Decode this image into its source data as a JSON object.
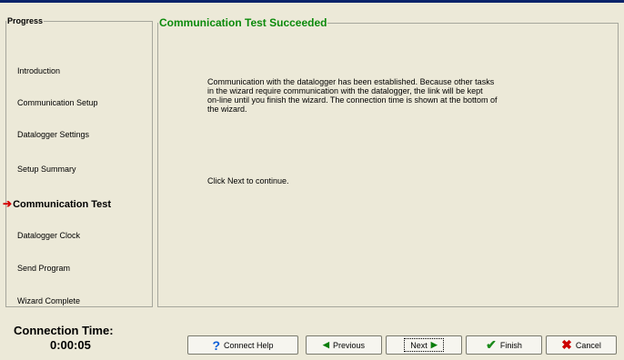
{
  "progress": {
    "title": "Progress",
    "steps": [
      {
        "label": "Introduction"
      },
      {
        "label": "Communication Setup"
      },
      {
        "label": "Datalogger Settings"
      },
      {
        "label": "Setup Summary"
      },
      {
        "label": "Communication Test"
      },
      {
        "label": "Datalogger Clock"
      },
      {
        "label": "Send Program"
      },
      {
        "label": "Wizard Complete"
      }
    ]
  },
  "content": {
    "title": "Communication Test Succeeded",
    "line1": "Communication with the datalogger has been established.  Because other tasks",
    "line2": "in the wizard require communication with the datalogger, the link will be kept",
    "line3": "on-line until you finish the wizard.  The connection time is shown at the bottom of",
    "line4": "the wizard.",
    "next_instruction": "Click Next to continue."
  },
  "connection": {
    "label": "Connection Time:",
    "value": "0:00:05"
  },
  "buttons": {
    "help": "Connect Help",
    "previous": "Previous",
    "next": "Next",
    "finish": "Finish",
    "cancel": "Cancel"
  },
  "icons": {
    "current_step": "red-arrow-icon",
    "help": "question-icon",
    "previous": "left-triangle-icon",
    "next": "right-triangle-icon",
    "finish": "check-icon",
    "cancel": "red-x-icon"
  },
  "colors": {
    "accent_title": "#0c8a0c",
    "current_arrow": "#d40000"
  }
}
